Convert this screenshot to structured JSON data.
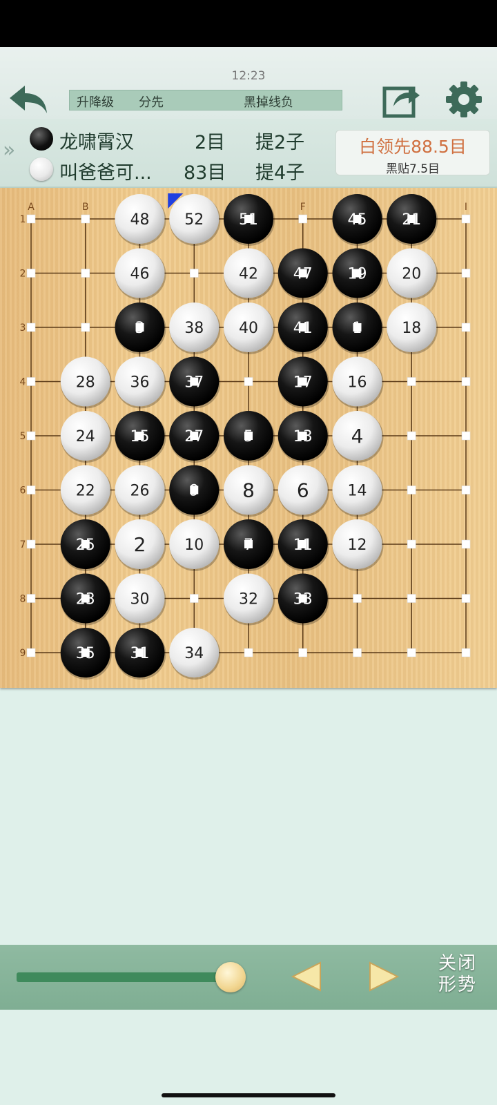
{
  "status": {
    "time": "12:23"
  },
  "header": {
    "back_icon": "back-arrow-icon",
    "share_icon": "share-icon",
    "settings_icon": "gear-icon",
    "info": {
      "level": "升降级",
      "handicap": "分先",
      "result": "黑掉线负"
    }
  },
  "players": {
    "black": {
      "name": "龙啸霄汉",
      "territory": "2目",
      "captures": "提2子"
    },
    "white": {
      "name": "叫爸爸可...",
      "territory": "83目",
      "captures": "提4子"
    },
    "score": {
      "lead": "白领先88.5目",
      "komi": "黑贴7.5目"
    }
  },
  "board": {
    "col_labels": [
      "A",
      "B",
      "",
      "",
      "",
      "F",
      "",
      "",
      "I"
    ],
    "row_labels": [
      "1",
      "2",
      "3",
      "4",
      "5",
      "6",
      "7",
      "8",
      "9"
    ],
    "colors": {
      "black": "#111111",
      "white": "#f4f4f4",
      "last_move_marker": "#1f3fe0"
    },
    "last_move": "52",
    "stones": [
      {
        "col": 2,
        "row": 0,
        "color": "white",
        "num": "48"
      },
      {
        "col": 3,
        "row": 0,
        "color": "white",
        "num": "52"
      },
      {
        "col": 4,
        "row": 0,
        "color": "black",
        "num": "51"
      },
      {
        "col": 6,
        "row": 0,
        "color": "black",
        "num": "45"
      },
      {
        "col": 7,
        "row": 0,
        "color": "black",
        "num": "21"
      },
      {
        "col": 2,
        "row": 1,
        "color": "white",
        "num": "46"
      },
      {
        "col": 4,
        "row": 1,
        "color": "white",
        "num": "42"
      },
      {
        "col": 5,
        "row": 1,
        "color": "black",
        "num": "47"
      },
      {
        "col": 6,
        "row": 1,
        "color": "black",
        "num": "19"
      },
      {
        "col": 7,
        "row": 1,
        "color": "white",
        "num": "20"
      },
      {
        "col": 2,
        "row": 2,
        "color": "black",
        "num": "3"
      },
      {
        "col": 3,
        "row": 2,
        "color": "white",
        "num": "38"
      },
      {
        "col": 4,
        "row": 2,
        "color": "white",
        "num": "40"
      },
      {
        "col": 5,
        "row": 2,
        "color": "black",
        "num": "41"
      },
      {
        "col": 6,
        "row": 2,
        "color": "black",
        "num": "1"
      },
      {
        "col": 7,
        "row": 2,
        "color": "white",
        "num": "18"
      },
      {
        "col": 1,
        "row": 3,
        "color": "white",
        "num": "28"
      },
      {
        "col": 2,
        "row": 3,
        "color": "white",
        "num": "36"
      },
      {
        "col": 3,
        "row": 3,
        "color": "black",
        "num": "37"
      },
      {
        "col": 5,
        "row": 3,
        "color": "black",
        "num": "17"
      },
      {
        "col": 6,
        "row": 3,
        "color": "white",
        "num": "16"
      },
      {
        "col": 1,
        "row": 4,
        "color": "white",
        "num": "24"
      },
      {
        "col": 2,
        "row": 4,
        "color": "black",
        "num": "15"
      },
      {
        "col": 3,
        "row": 4,
        "color": "black",
        "num": "27"
      },
      {
        "col": 4,
        "row": 4,
        "color": "black",
        "num": "5"
      },
      {
        "col": 5,
        "row": 4,
        "color": "black",
        "num": "13"
      },
      {
        "col": 6,
        "row": 4,
        "color": "white",
        "num": "4"
      },
      {
        "col": 1,
        "row": 5,
        "color": "white",
        "num": "22"
      },
      {
        "col": 2,
        "row": 5,
        "color": "white",
        "num": "26"
      },
      {
        "col": 3,
        "row": 5,
        "color": "black",
        "num": "9"
      },
      {
        "col": 4,
        "row": 5,
        "color": "white",
        "num": "8"
      },
      {
        "col": 5,
        "row": 5,
        "color": "white",
        "num": "6"
      },
      {
        "col": 6,
        "row": 5,
        "color": "white",
        "num": "14"
      },
      {
        "col": 1,
        "row": 6,
        "color": "black",
        "num": "25"
      },
      {
        "col": 2,
        "row": 6,
        "color": "white",
        "num": "2"
      },
      {
        "col": 3,
        "row": 6,
        "color": "white",
        "num": "10"
      },
      {
        "col": 4,
        "row": 6,
        "color": "black",
        "num": "7"
      },
      {
        "col": 5,
        "row": 6,
        "color": "black",
        "num": "11"
      },
      {
        "col": 6,
        "row": 6,
        "color": "white",
        "num": "12"
      },
      {
        "col": 1,
        "row": 7,
        "color": "black",
        "num": "23"
      },
      {
        "col": 2,
        "row": 7,
        "color": "white",
        "num": "30"
      },
      {
        "col": 4,
        "row": 7,
        "color": "white",
        "num": "32"
      },
      {
        "col": 5,
        "row": 7,
        "color": "black",
        "num": "33"
      },
      {
        "col": 1,
        "row": 8,
        "color": "black",
        "num": "35"
      },
      {
        "col": 2,
        "row": 8,
        "color": "black",
        "num": "31"
      },
      {
        "col": 3,
        "row": 8,
        "color": "white",
        "num": "34"
      }
    ]
  },
  "controls": {
    "progress": 0.97,
    "prev_icon": "triangle-left-icon",
    "next_icon": "triangle-right-icon",
    "close_label_line1": "关闭",
    "close_label_line2": "形势"
  }
}
